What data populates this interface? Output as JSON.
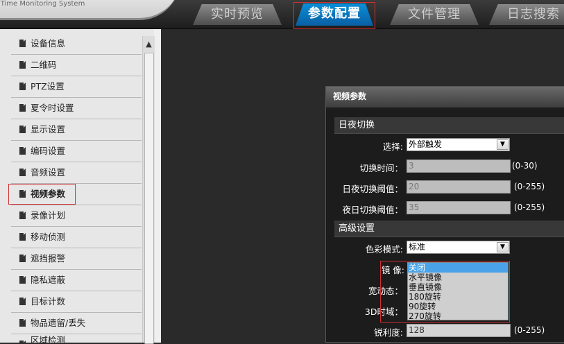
{
  "header": {
    "logo_text": "... Time Monitoring System",
    "tabs": [
      {
        "label": "实时预览"
      },
      {
        "label": "参数配置"
      },
      {
        "label": "文件管理"
      },
      {
        "label": "日志搜索"
      }
    ]
  },
  "sidebar": {
    "items": [
      {
        "label": "设备信息"
      },
      {
        "label": "二维码"
      },
      {
        "label": "PTZ设置"
      },
      {
        "label": "夏令时设置"
      },
      {
        "label": "显示设置"
      },
      {
        "label": "编码设置"
      },
      {
        "label": "音频设置"
      },
      {
        "label": "视频参数"
      },
      {
        "label": "录像计划"
      },
      {
        "label": "移动侦测"
      },
      {
        "label": "遮挡报警"
      },
      {
        "label": "隐私遮蔽"
      },
      {
        "label": "目标计数"
      },
      {
        "label": "物品遗留/丢失"
      },
      {
        "label": "区域检测"
      }
    ],
    "scroll_up": "▲"
  },
  "panel": {
    "title": "视频参数",
    "daynight": {
      "section": "日夜切换",
      "select_label": "选择:",
      "select_value": "外部触发",
      "switch_time_label": "切换时间：",
      "switch_time_value": "3",
      "switch_time_range": "(0-30)",
      "day_threshold_label": "日夜切换阈值：",
      "day_threshold_value": "20",
      "day_threshold_range": "(0-255)",
      "night_threshold_label": "夜日切换阈值：",
      "night_threshold_value": "35",
      "night_threshold_range": "(0-255)"
    },
    "advanced": {
      "section": "高级设置",
      "color_mode_label": "色彩模式:",
      "color_mode_value": "标准",
      "mirror_label": "镜 像:",
      "mirror_options": [
        "关闭",
        "水平镜像",
        "垂直镜像",
        "180旋转",
        "90旋转",
        "270旋转"
      ],
      "wdr_label": "宽动态：",
      "dnr_label": "3D时域：",
      "sharpness_label": "锐利度:",
      "sharpness_value": "128",
      "sharpness_range": "(0-255)"
    },
    "arrow_glyph": "▼"
  }
}
